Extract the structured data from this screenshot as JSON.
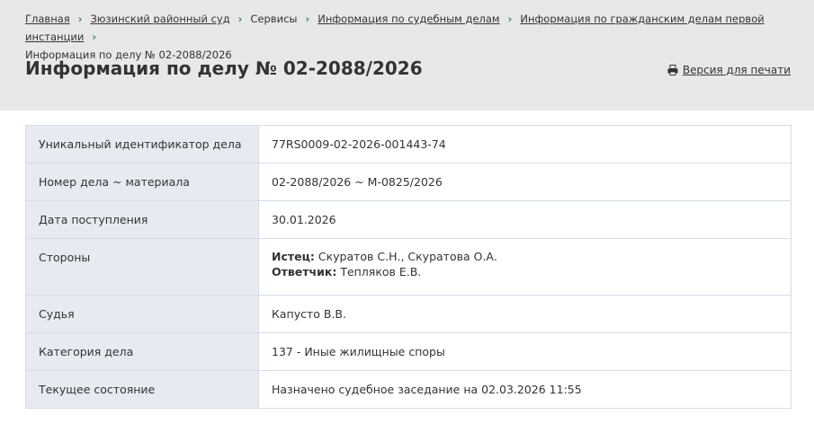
{
  "breadcrumbs": [
    {
      "label": "Главная",
      "link": true
    },
    {
      "label": "Зюзинский районный суд",
      "link": true
    },
    {
      "label": "Сервисы",
      "link": false
    },
    {
      "label": "Информация по судебным делам",
      "link": true
    },
    {
      "label": "Информация по гражданским делам первой инстанции",
      "link": true
    },
    {
      "label": "Информация по делу № 02-2088/2026",
      "link": false
    }
  ],
  "title": "Информация по делу № 02-2088/2026",
  "print_label": "Версия для печати",
  "rows": [
    {
      "label": "Уникальный идентификатор дела",
      "value": "77RS0009-02-2026-001443-74"
    },
    {
      "label": "Номер дела ~ материала",
      "value": "02-2088/2026 ~ М-0825/2026"
    },
    {
      "label": "Дата поступления",
      "value": "30.01.2026"
    },
    {
      "label": "Стороны",
      "plaintiff_label": "Истец:",
      "plaintiff": "Скуратов С.Н., Скуратова О.А.",
      "defendant_label": "Ответчик:",
      "defendant": "Тепляков Е.В."
    },
    {
      "label": "Судья",
      "value": "Капусто В.В."
    },
    {
      "label": "Категория дела",
      "value": "137 - Иные жилищные споры"
    },
    {
      "label": "Текущее состояние",
      "value": "Назначено судебное заседание на 02.03.2026 11:55"
    }
  ]
}
